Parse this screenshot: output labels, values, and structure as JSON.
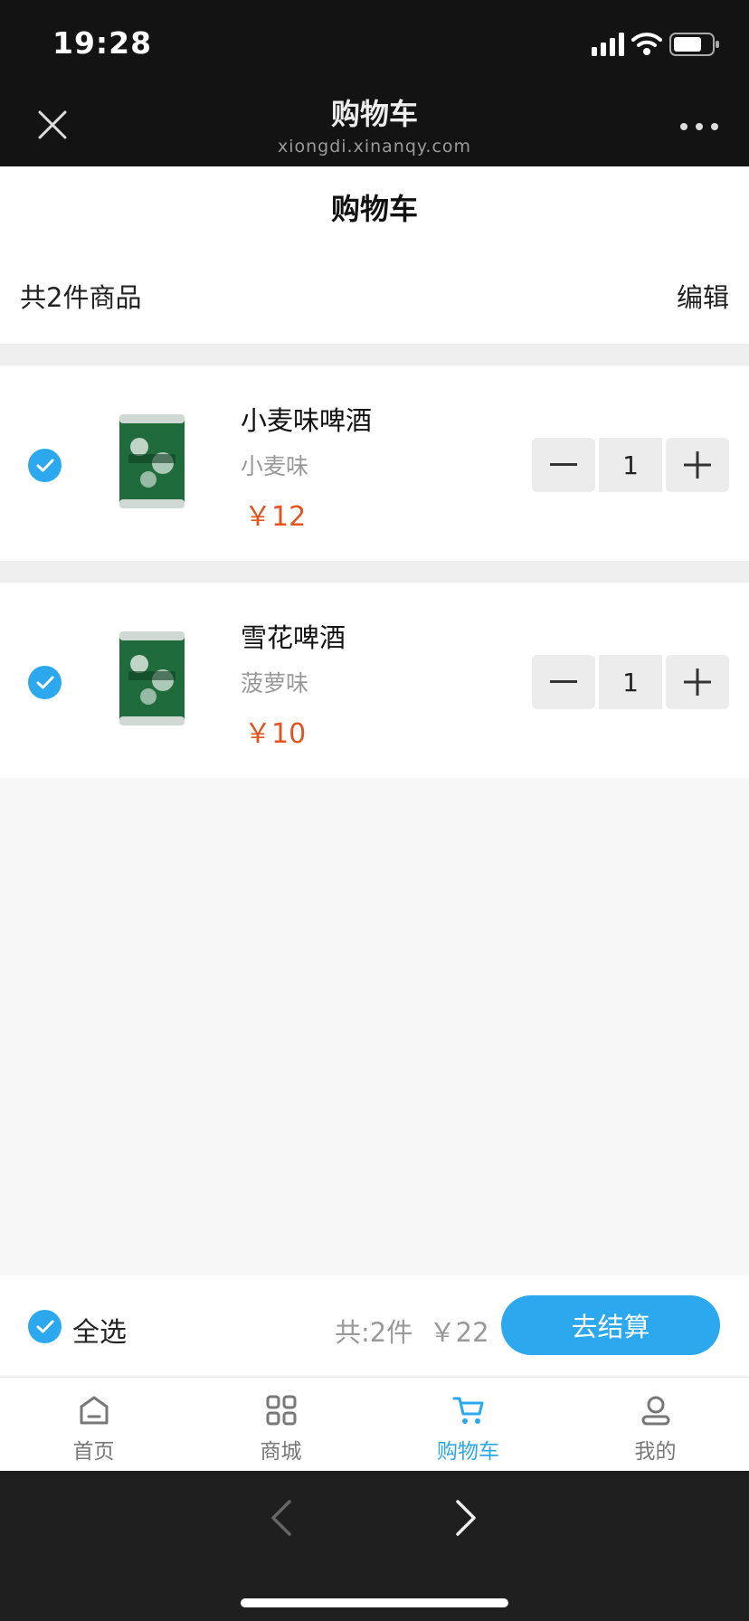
{
  "status_bar": {
    "time": "19:28"
  },
  "browser": {
    "title": "购物车",
    "url": "xiongdi.xinanqy.com"
  },
  "page": {
    "title": "购物车",
    "item_count_text": "共2件商品",
    "edit_label": "编辑"
  },
  "cart_items": [
    {
      "name": "小麦味啤酒",
      "flavor": "小麦味",
      "price": "￥12",
      "quantity": "1",
      "checked": true
    },
    {
      "name": "雪花啤酒",
      "flavor": "菠萝味",
      "price": "￥10",
      "quantity": "1",
      "checked": true
    }
  ],
  "checkout": {
    "select_all_label": "全选",
    "total_text": "共:2件  ￥22",
    "pay_label": "去结算"
  },
  "tabbar": {
    "items": [
      {
        "label": "首页",
        "icon": "home-icon",
        "active": false
      },
      {
        "label": "商城",
        "icon": "grid-icon",
        "active": false
      },
      {
        "label": "购物车",
        "icon": "cart-icon",
        "active": true
      },
      {
        "label": "我的",
        "icon": "user-icon",
        "active": false
      }
    ]
  },
  "colors": {
    "accent": "#2ba8ee",
    "price": "#e5531f",
    "header_bg": "#131313"
  }
}
